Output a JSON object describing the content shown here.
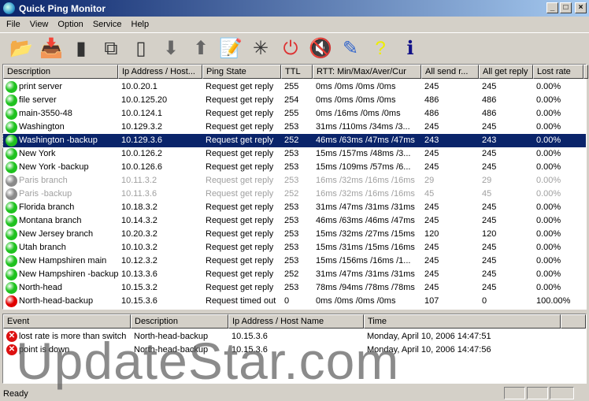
{
  "window": {
    "title": "Quick Ping Monitor",
    "minimize": "_",
    "maximize": "□",
    "close": "×"
  },
  "menu": [
    "File",
    "View",
    "Option",
    "Service",
    "Help"
  ],
  "toolbar": [
    {
      "name": "open-folder-icon",
      "glyph": "📂"
    },
    {
      "name": "import-icon",
      "glyph": "📥"
    },
    {
      "name": "new-item-icon",
      "glyph": "▮"
    },
    {
      "name": "copy-items-icon",
      "glyph": "⧉"
    },
    {
      "name": "blank-item-icon",
      "glyph": "▯"
    },
    {
      "name": "move-down-icon",
      "glyph": "⬇"
    },
    {
      "name": "move-up-icon",
      "glyph": "⬆"
    },
    {
      "name": "settings-notes-icon",
      "glyph": "📝"
    },
    {
      "name": "start-icon",
      "glyph": "✳"
    },
    {
      "name": "stop-icon",
      "glyph": "⏻"
    },
    {
      "name": "mute-sound-icon",
      "glyph": "🔇"
    },
    {
      "name": "edit-log-icon",
      "glyph": "✎"
    },
    {
      "name": "help-icon",
      "glyph": "?"
    },
    {
      "name": "about-icon",
      "glyph": "ℹ"
    }
  ],
  "columns": [
    "Description",
    "Ip Address / Host...",
    "Ping State",
    "TTL",
    "RTT: Min/Max/Aver/Cur",
    "All send r...",
    "All get reply",
    "Lost rate"
  ],
  "rows": [
    {
      "status": "up",
      "desc": "print server",
      "ip": "10.0.20.1",
      "state": "Request get reply",
      "ttl": "255",
      "rtt": "0ms /0ms /0ms /0ms",
      "send": "245",
      "get": "245",
      "lost": "0.00%"
    },
    {
      "status": "up",
      "desc": "file server",
      "ip": "10.0.125.20",
      "state": "Request get reply",
      "ttl": "254",
      "rtt": "0ms /0ms /0ms /0ms",
      "send": "486",
      "get": "486",
      "lost": "0.00%"
    },
    {
      "status": "up",
      "desc": "main-3550-48",
      "ip": "10.0.124.1",
      "state": "Request get reply",
      "ttl": "255",
      "rtt": "0ms /16ms /0ms /0ms",
      "send": "486",
      "get": "486",
      "lost": "0.00%"
    },
    {
      "status": "up",
      "desc": "Washington",
      "ip": "10.129.3.2",
      "state": "Request get reply",
      "ttl": "253",
      "rtt": "31ms /110ms /34ms /3...",
      "send": "245",
      "get": "245",
      "lost": "0.00%"
    },
    {
      "status": "up",
      "desc": "Washington -backup",
      "ip": "10.129.3.6",
      "state": "Request get reply",
      "ttl": "252",
      "rtt": "46ms /63ms /47ms /47ms",
      "send": "243",
      "get": "243",
      "lost": "0.00%",
      "selected": true
    },
    {
      "status": "up",
      "desc": "New York",
      "ip": "10.0.126.2",
      "state": "Request get reply",
      "ttl": "253",
      "rtt": "15ms /157ms /48ms /3...",
      "send": "245",
      "get": "245",
      "lost": "0.00%"
    },
    {
      "status": "up",
      "desc": "New York -backup",
      "ip": "10.0.126.6",
      "state": "Request get reply",
      "ttl": "253",
      "rtt": "15ms /109ms /57ms /6...",
      "send": "245",
      "get": "245",
      "lost": "0.00%"
    },
    {
      "status": "disabled",
      "desc": "Paris  branch",
      "ip": "10.11.3.2",
      "state": "Request get reply",
      "ttl": "253",
      "rtt": "16ms /32ms /16ms /16ms",
      "send": "29",
      "get": "29",
      "lost": "0.00%"
    },
    {
      "status": "disabled",
      "desc": "Paris  -backup",
      "ip": "10.11.3.6",
      "state": "Request get reply",
      "ttl": "252",
      "rtt": "16ms /32ms /16ms /16ms",
      "send": "45",
      "get": "45",
      "lost": "0.00%"
    },
    {
      "status": "up",
      "desc": "Florida  branch",
      "ip": "10.18.3.2",
      "state": "Request get reply",
      "ttl": "253",
      "rtt": "31ms /47ms /31ms /31ms",
      "send": "245",
      "get": "245",
      "lost": "0.00%"
    },
    {
      "status": "up",
      "desc": "Montana  branch",
      "ip": "10.14.3.2",
      "state": "Request get reply",
      "ttl": "253",
      "rtt": "46ms /63ms /46ms /47ms",
      "send": "245",
      "get": "245",
      "lost": "0.00%"
    },
    {
      "status": "up",
      "desc": "New Jersey branch",
      "ip": "10.20.3.2",
      "state": "Request get reply",
      "ttl": "253",
      "rtt": "15ms /32ms /27ms /15ms",
      "send": "120",
      "get": "120",
      "lost": "0.00%"
    },
    {
      "status": "up",
      "desc": "Utah branch",
      "ip": "10.10.3.2",
      "state": "Request get reply",
      "ttl": "253",
      "rtt": "15ms /31ms /15ms /16ms",
      "send": "245",
      "get": "245",
      "lost": "0.00%"
    },
    {
      "status": "up",
      "desc": "New Hampshiren main",
      "ip": "10.12.3.2",
      "state": "Request get reply",
      "ttl": "253",
      "rtt": "15ms /156ms /16ms /1...",
      "send": "245",
      "get": "245",
      "lost": "0.00%"
    },
    {
      "status": "up",
      "desc": "New Hampshiren -backup",
      "ip": "10.13.3.6",
      "state": "Request get reply",
      "ttl": "252",
      "rtt": "31ms /47ms /31ms /31ms",
      "send": "245",
      "get": "245",
      "lost": "0.00%"
    },
    {
      "status": "up",
      "desc": "North-head",
      "ip": "10.15.3.2",
      "state": "Request get reply",
      "ttl": "253",
      "rtt": "78ms /94ms /78ms /78ms",
      "send": "245",
      "get": "245",
      "lost": "0.00%"
    },
    {
      "status": "down",
      "desc": "North-head-backup",
      "ip": "10.15.3.6",
      "state": "Request timed out",
      "ttl": "0",
      "rtt": "0ms /0ms /0ms /0ms",
      "send": "107",
      "get": "0",
      "lost": "100.00%"
    }
  ],
  "status_colors": {
    "up": "#1fc21f",
    "down": "#e00000",
    "disabled": "#8a8a8a"
  },
  "event_columns": [
    "Event",
    "Description",
    "Ip Address / Host Name",
    "Time"
  ],
  "events": [
    {
      "event": "lost rate is more than switch",
      "desc": "North-head-backup",
      "ip": "10.15.3.6",
      "time": "Monday, April 10, 2006  14:47:51"
    },
    {
      "event": "point is down",
      "desc": "North-head-backup",
      "ip": "10.15.3.6",
      "time": "Monday, April 10, 2006  14:47:56"
    }
  ],
  "watermark": "UpdateStar.com",
  "statusbar": {
    "text": "Ready"
  }
}
